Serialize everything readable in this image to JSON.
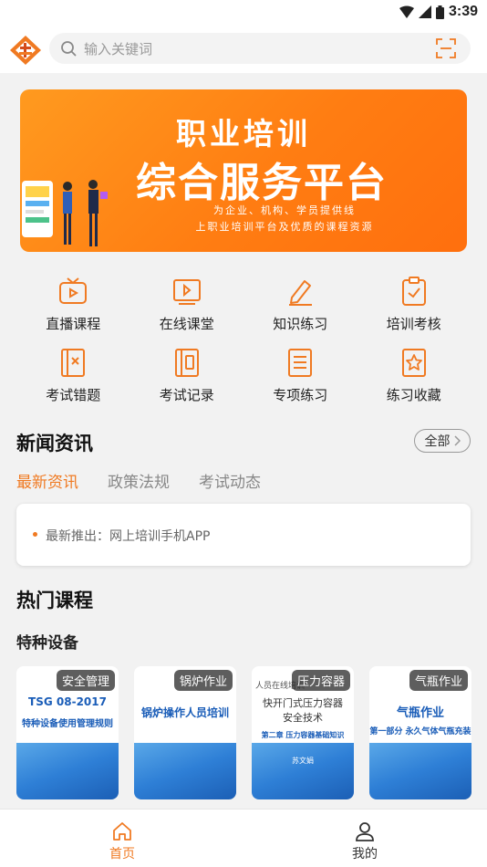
{
  "status_bar": {
    "time": "3:39",
    "icons": [
      "wifi-icon",
      "signal-icon",
      "battery-icon"
    ]
  },
  "search": {
    "placeholder": "输入关键词"
  },
  "banner": {
    "line1": "职业培训",
    "line2": "综合服务平台",
    "line3": "为企业、机构、学员提供线",
    "line4": "上职业培训平台及优质的课程资源"
  },
  "menu": [
    {
      "label": "直播课程",
      "icon": "tv-icon"
    },
    {
      "label": "在线课堂",
      "icon": "video-icon"
    },
    {
      "label": "知识练习",
      "icon": "pencil-icon"
    },
    {
      "label": "培训考核",
      "icon": "clipboard-check-icon"
    },
    {
      "label": "考试错题",
      "icon": "error-book-icon"
    },
    {
      "label": "考试记录",
      "icon": "record-icon"
    },
    {
      "label": "专项练习",
      "icon": "list-icon"
    },
    {
      "label": "练习收藏",
      "icon": "star-bookmark-icon"
    }
  ],
  "news": {
    "title": "新闻资讯",
    "all_label": "全部",
    "tabs": [
      "最新资讯",
      "政策法规",
      "考试动态"
    ],
    "items": [
      "最新推出：网上培训手机APP"
    ]
  },
  "courses": {
    "title": "热门课程",
    "category": "特种设备",
    "items": [
      {
        "tag": "安全管理",
        "cover_line1": "TSG 08-2017",
        "cover_line2": "特种设备使用管理规则"
      },
      {
        "tag": "锅炉作业",
        "cover_line1": "锅炉操作人员培训",
        "cover_line2": ""
      },
      {
        "tag": "压力容器",
        "cover_top": "人员在线培训",
        "cover_line1": "快开门式压力容器",
        "cover_line2": "安全技术",
        "cover_line3": "第二章  压力容器基础知识",
        "cover_line4": "苏文娟"
      },
      {
        "tag": "气瓶作业",
        "cover_line1": "气瓶作业",
        "cover_line2": "第一部分 永久气体气瓶充装"
      }
    ]
  },
  "bottom_nav": [
    {
      "label": "首页",
      "icon": "home-icon",
      "active": true
    },
    {
      "label": "我的",
      "icon": "user-icon",
      "active": false
    }
  ],
  "colors": {
    "accent": "#f07a22",
    "banner": "#ff7d12",
    "course_blue": "#2e7fd6"
  }
}
